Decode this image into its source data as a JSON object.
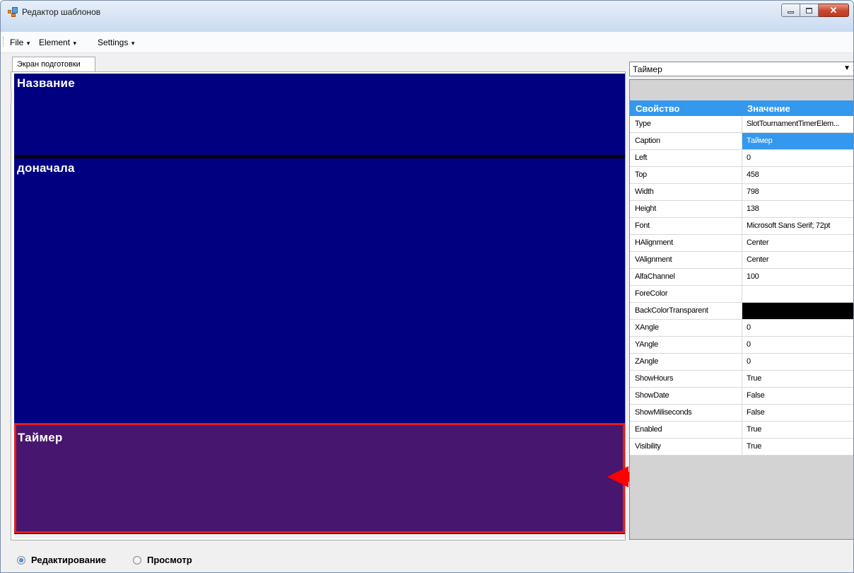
{
  "window": {
    "title": "Редактор шаблонов"
  },
  "menu": {
    "items": [
      "File",
      "Element",
      "Settings"
    ]
  },
  "tab": {
    "label": "Экран подготовки"
  },
  "canvas": {
    "elements": [
      {
        "caption": "Название"
      },
      {
        "caption": "доначала"
      },
      {
        "caption": "Таймер"
      }
    ]
  },
  "properties": {
    "selected_element": "Таймер",
    "header": {
      "property": "Свойство",
      "value": "Значение"
    },
    "rows": [
      {
        "key": "Type",
        "value": "SlotTournamentTimerElem..."
      },
      {
        "key": "Caption",
        "value": "Таймер"
      },
      {
        "key": "Left",
        "value": "0"
      },
      {
        "key": "Top",
        "value": "458"
      },
      {
        "key": "Width",
        "value": "798"
      },
      {
        "key": "Height",
        "value": "138"
      },
      {
        "key": "Font",
        "value": "Microsoft Sans Serif; 72pt"
      },
      {
        "key": "HAlignment",
        "value": "Center"
      },
      {
        "key": "VAlignment",
        "value": "Center"
      },
      {
        "key": "AlfaChannel",
        "value": "100"
      },
      {
        "key": "ForeColor",
        "value": ""
      },
      {
        "key": "BackColorTransparent",
        "value": ""
      },
      {
        "key": "XAngle",
        "value": "0"
      },
      {
        "key": "YAngle",
        "value": "0"
      },
      {
        "key": "ZAngle",
        "value": "0"
      },
      {
        "key": "ShowHours",
        "value": "True"
      },
      {
        "key": "ShowDate",
        "value": "False"
      },
      {
        "key": "ShowMiliseconds",
        "value": "False"
      },
      {
        "key": "Enabled",
        "value": "True"
      },
      {
        "key": "Visibility",
        "value": "True"
      }
    ]
  },
  "mode": {
    "edit_label": "Редактирование",
    "preview_label": "Просмотр",
    "selected": "edit"
  },
  "colors": {
    "element_bg": "#000080",
    "selected_element_bg": "#47166f",
    "selection_border": "#e31c1c",
    "grid_highlight": "#3498ee"
  }
}
